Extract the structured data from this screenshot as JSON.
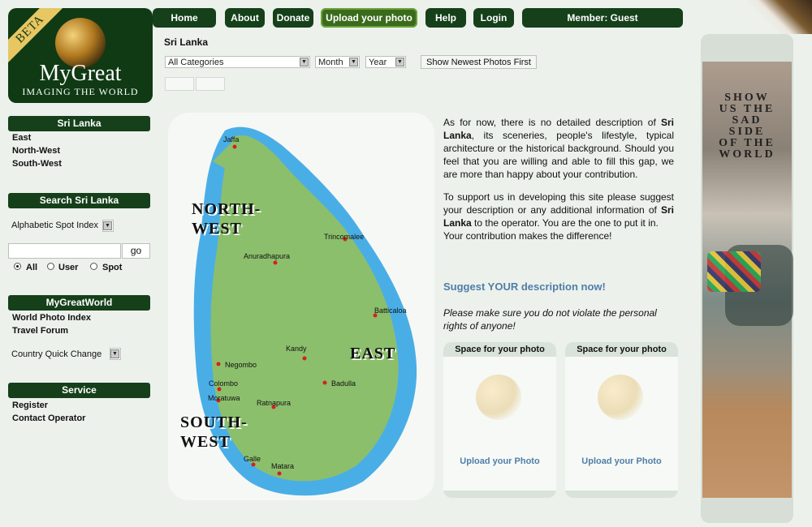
{
  "logo": {
    "beta": "BETA",
    "name": "MyGreat",
    "tagline": "IMAGING THE WORLD"
  },
  "nav": {
    "home": "Home",
    "about": "About",
    "donate": "Donate",
    "upload": "Upload your photo",
    "help": "Help",
    "login": "Login",
    "member": "Member: Guest"
  },
  "page_title": "Sri Lanka",
  "filters": {
    "category": "All Categories",
    "month": "Month",
    "year": "Year",
    "show_newest": "Show Newest Photos First"
  },
  "sidebar": {
    "region_title": "Sri Lanka",
    "regions": [
      "East",
      "North-West",
      "South-West"
    ],
    "search_title": "Search Sri Lanka",
    "alpha_index": "Alphabetic Spot Index",
    "go": "go",
    "radio_all": "All",
    "radio_user": "User",
    "radio_spot": "Spot",
    "mgw_title": "MyGreatWorld",
    "mgw_links": [
      "World Photo Index",
      "Travel Forum"
    ],
    "country_quick": "Country Quick Change",
    "service_title": "Service",
    "service_links": [
      "Register",
      "Contact Operator"
    ]
  },
  "map": {
    "regions": {
      "nw": "NORTH-WEST",
      "east": "EAST",
      "sw": "SOUTH-WEST"
    },
    "cities": [
      "Jaffa",
      "Trincomalee",
      "Anuradhapura",
      "Batticaloa",
      "Kandy",
      "Negombo",
      "Badulla",
      "Colombo",
      "Moratuwa",
      "Ratnapura",
      "Galle",
      "Matara"
    ]
  },
  "description": {
    "p1_a": "As for now, there is no detailed description of ",
    "p1_b": "Sri Lanka",
    "p1_c": ", its sceneries, people's lifestyle, typical architecture or the historical background. Should you feel that you are willing and able to fill this gap, we are more than happy about your contribution.",
    "p2_a": "To support us in developing this site please suggest your description or any additional information of ",
    "p2_b": "Sri Lanka",
    "p2_c": " to the operator. You are the one to put it in.",
    "p3": "Your contribution makes the difference!",
    "suggest": "Suggest YOUR description now!",
    "warn": "Please make sure you do not violate the personal rights of anyone!"
  },
  "upload_cards": [
    {
      "header": "Space for your photo",
      "link": "Upload your Photo"
    },
    {
      "header": "Space for your photo",
      "link": "Upload your Photo"
    }
  ],
  "banner": {
    "lines": [
      "SHOW",
      "US THE",
      "SAD",
      "SIDE",
      "OF THE",
      "WORLD"
    ]
  },
  "colors": {
    "dark_green": "#15401a",
    "link_blue": "#4f7ea8",
    "bg": "#ecf1ec"
  }
}
